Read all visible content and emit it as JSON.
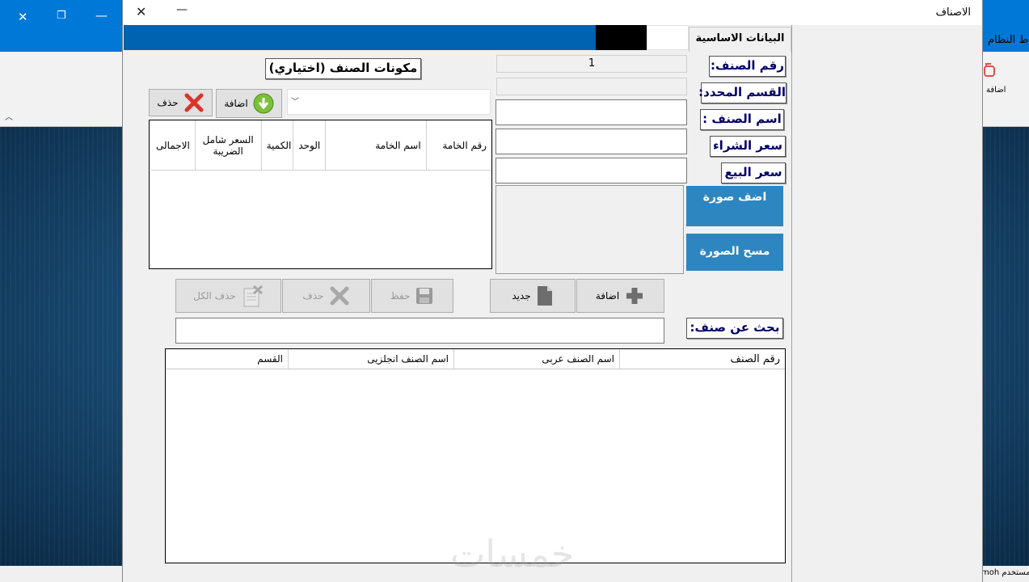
{
  "background_app": {
    "ribbon_label": "ط النظام",
    "ribbon_button": "اضافة",
    "status_text": "المستخدم moh"
  },
  "dialog": {
    "title": "الاصناف",
    "tab_basic": "البيانات الاساسية"
  },
  "labels": {
    "item_no": "رقم الصنف:",
    "section": "القسم المحدد:",
    "item_name": "اسم الصنف :",
    "purchase_price": "سعر الشراء",
    "sale_price": "سعر البيع",
    "components_title": "مكونات الصنف (اختياري)",
    "search": "بحث عن صنف:"
  },
  "fields": {
    "item_no_value": "1"
  },
  "buttons": {
    "add_image": "اضف صورة",
    "clear_image": "مسح الصورة",
    "component_add": "اضافة",
    "component_delete": "حذف",
    "delete_all": "حذف الكل",
    "delete": "حذف",
    "save": "حفظ",
    "new": "جديد",
    "add": "اضافة"
  },
  "components_table": {
    "columns": [
      "رقم الخامة",
      "اسم الخامة",
      "الوحد",
      "الكمية",
      "السعر شامل الضريبة",
      "الاجمالى"
    ]
  },
  "items_table": {
    "columns": [
      "رقم الصنف",
      "اسم الصنف عربى",
      "اسم الصنف انجلزيى",
      "القسم"
    ]
  },
  "watermark": "خمسات",
  "colors": {
    "accent_blue": "#0063b1",
    "button_blue": "#2e86c1",
    "label_text": "#000066",
    "delete_red": "#d9342b",
    "add_green": "#5aa02c"
  }
}
